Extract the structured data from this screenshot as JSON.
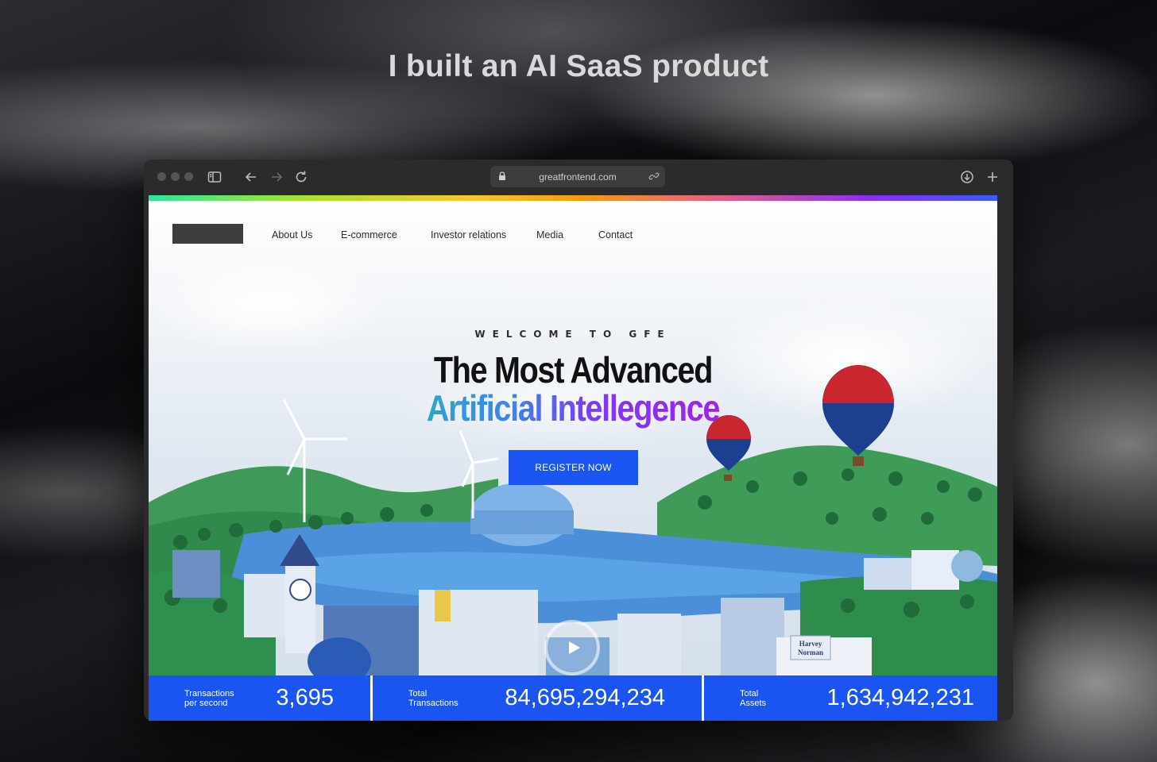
{
  "headline": "I built an AI SaaS product",
  "browser": {
    "url": "greatfrontend.com"
  },
  "site": {
    "nav": [
      {
        "label": "About Us"
      },
      {
        "label": "E-commerce"
      },
      {
        "label": "Investor relations"
      },
      {
        "label": "Media"
      },
      {
        "label": "Contact"
      }
    ],
    "hero": {
      "eyebrow": "WELCOME TO GFE",
      "title_line1": "The Most Advanced",
      "title_line2": "Artificial Intellegence",
      "cta_label": "REGISTER NOW"
    },
    "stats": [
      {
        "label_line1": "Transactions",
        "label_line2": "per second",
        "value": "3,695"
      },
      {
        "label_line1": "Total",
        "label_line2": "Transactions",
        "value": "84,695,294,234"
      },
      {
        "label_line1": "Total",
        "label_line2": "Assets",
        "value": "1,634,942,231"
      }
    ],
    "billboard": {
      "line1": "Harvey",
      "line2": "Norman"
    }
  },
  "colors": {
    "accent": "#1a55f2",
    "browser_chrome": "#2b2b2d"
  }
}
